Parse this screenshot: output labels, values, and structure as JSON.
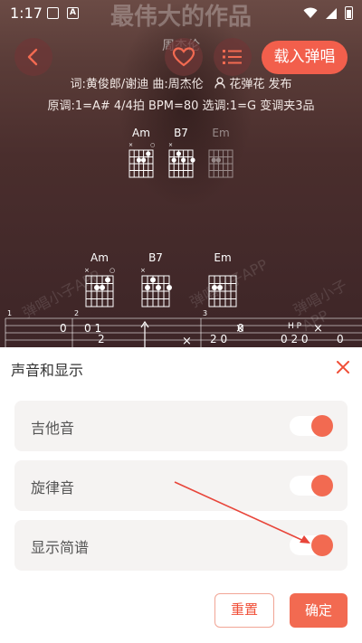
{
  "status_bar": {
    "time": "1:17",
    "icons": [
      "image-icon",
      "a-icon",
      "wifi-icon",
      "signal-icon",
      "battery-icon"
    ]
  },
  "song": {
    "title": "最伟大的作品",
    "singer": "周杰伦",
    "credits": "词:黄俊郎/谢迪 曲:周杰伦",
    "publisher": "花弹花 发布",
    "key_info": "原调:1=A# 4/4拍 BPM=80  选调:1=G 变调夹3品"
  },
  "header": {
    "load_button": "载入弹唱"
  },
  "chords_top": [
    "Am",
    "B7",
    "Em"
  ],
  "chords_row": [
    "Am",
    "B7",
    "Em"
  ],
  "tab_preview": {
    "measures": [
      "1",
      "2",
      "3"
    ],
    "text1": "0",
    "text2": "0 1",
    "text3": "2",
    "text4": "2 0",
    "text5": "0",
    "text6": "H P",
    "text7": "0 2 0",
    "text8": "0"
  },
  "watermark": "弹唱小子APP",
  "sheet": {
    "title": "声音和显示",
    "settings": [
      {
        "label": "吉他音",
        "enabled": true
      },
      {
        "label": "旋律音",
        "enabled": true
      },
      {
        "label": "显示简谱",
        "enabled": true
      }
    ],
    "reset_button": "重置",
    "confirm_button": "确定"
  },
  "colors": {
    "accent": "#f26a51",
    "header_bg": "#4a2e2d",
    "row_bg": "#f5f3f2"
  }
}
